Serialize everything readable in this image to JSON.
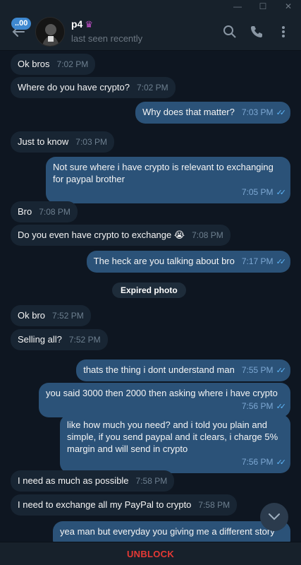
{
  "window": {
    "minimize": "—",
    "maximize": "☐",
    "close": "✕"
  },
  "header": {
    "unread_badge": "..00",
    "contact_name": "p4",
    "status": "last seen recently"
  },
  "messages": [
    {
      "dir": "in",
      "text": "Ok bros",
      "time": "7:02 PM"
    },
    {
      "dir": "in",
      "text": "Where do you have crypto?",
      "time": "7:02 PM"
    },
    {
      "dir": "out",
      "text": "Why does that matter?",
      "time": "7:03 PM"
    },
    {
      "dir": "in",
      "text": "Just to know",
      "time": "7:03 PM"
    },
    {
      "dir": "out",
      "text": "Not sure where i have crypto is relevant to exchanging for paypal brother",
      "time": "7:05 PM"
    },
    {
      "dir": "in",
      "text": "Bro",
      "time": "7:08 PM"
    },
    {
      "dir": "in",
      "text": "Do you even have crypto to exchange 😭",
      "time": "7:08 PM"
    },
    {
      "dir": "out",
      "text": "The heck are you talking about bro",
      "time": "7:17 PM"
    },
    {
      "dir": "in",
      "text": "Ok bro",
      "time": "7:52 PM"
    },
    {
      "dir": "in",
      "text": "Selling all?",
      "time": "7:52 PM"
    },
    {
      "dir": "out",
      "text": "thats the thing i dont understand man",
      "time": "7:55 PM"
    },
    {
      "dir": "out",
      "text": "you said 3000 then 2000 then asking where i have crypto",
      "time": "7:56 PM"
    },
    {
      "dir": "out",
      "text": "like how much you need? and i told you plain and simple, if you send paypal and it clears, i charge 5% margin and will send in crypto",
      "time": "7:56 PM"
    },
    {
      "dir": "in",
      "text": "I need as much as possible",
      "time": "7:58 PM"
    },
    {
      "dir": "in",
      "text": "I need to exchange all my PayPal to crypto",
      "time": "7:58 PM"
    },
    {
      "dir": "out",
      "text": "yea man but everyday you giving me a different story",
      "time": ""
    }
  ],
  "service_message": "Expired photo",
  "bottom": {
    "unblock_label": "UNBLOCK"
  },
  "colors": {
    "background": "#0e1621",
    "incoming_bubble": "#182533",
    "outgoing_bubble": "#2b5278",
    "accent": "#5eb5f7",
    "unblock": "#e53935"
  }
}
